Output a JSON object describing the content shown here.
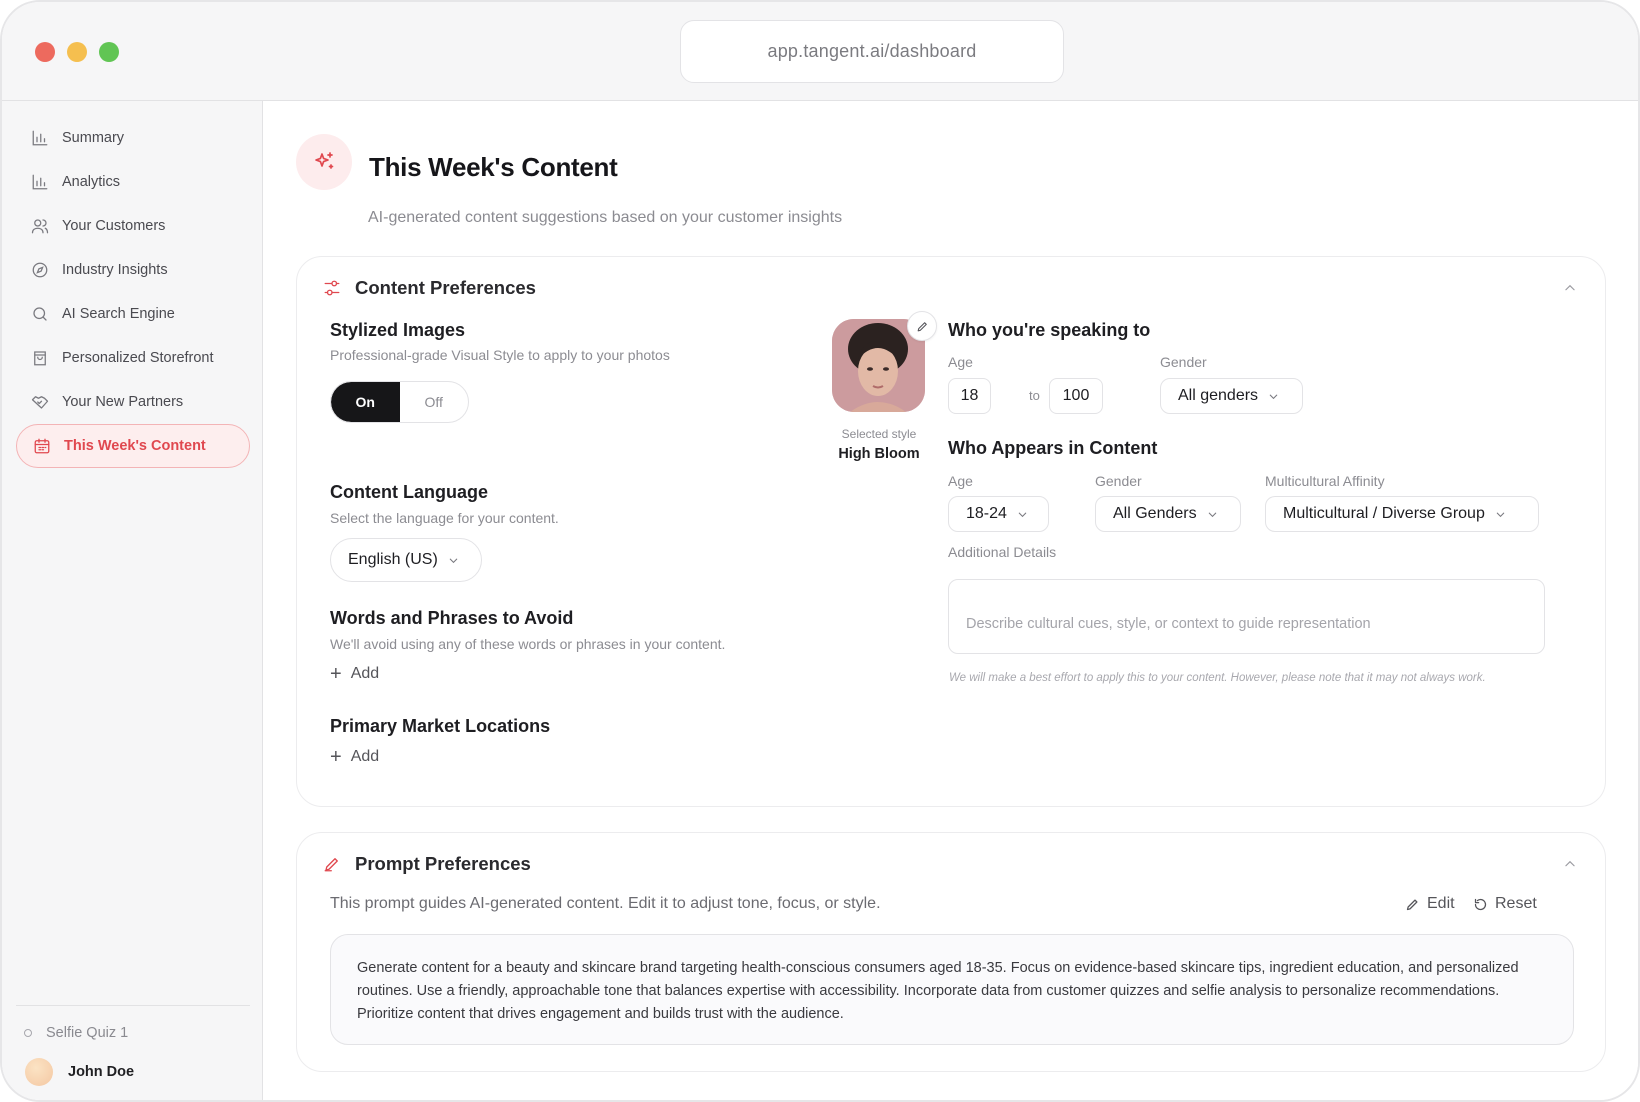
{
  "window": {
    "url": "app.tangent.ai/dashboard"
  },
  "sidebar": {
    "items": [
      {
        "label": "Summary",
        "icon": "bar-chart-icon"
      },
      {
        "label": "Analytics",
        "icon": "bar-chart-icon"
      },
      {
        "label": "Your Customers",
        "icon": "users-icon"
      },
      {
        "label": "Industry Insights",
        "icon": "compass-icon"
      },
      {
        "label": "AI Search Engine",
        "icon": "search-icon"
      },
      {
        "label": "Personalized Storefront",
        "icon": "bag-icon"
      },
      {
        "label": "Your New Partners",
        "icon": "handshake-icon"
      },
      {
        "label": "This Week's Content",
        "icon": "calendar-icon",
        "active": true
      }
    ],
    "quiz_label": "Selfie Quiz 1",
    "user_name": "John Doe"
  },
  "page": {
    "title": "This Week's Content",
    "subtitle": "AI-generated content suggestions based on your customer insights",
    "accent_color": "#e0484f"
  },
  "content_preferences": {
    "title": "Content Preferences",
    "stylized_images": {
      "title": "Stylized Images",
      "description": "Professional-grade Visual Style to apply to your photos",
      "on_label": "On",
      "off_label": "Off",
      "selected": "On",
      "selected_style_caption": "Selected style",
      "selected_style_name": "High Bloom"
    },
    "content_language": {
      "title": "Content Language",
      "description": "Select the language for your content.",
      "value": "English (US)"
    },
    "words_to_avoid": {
      "title": "Words and Phrases to Avoid",
      "description": "We'll avoid using any of these words or phrases in your content.",
      "add_label": "Add"
    },
    "primary_markets": {
      "title": "Primary Market Locations",
      "add_label": "Add"
    },
    "speaking_to": {
      "title": "Who you're speaking to",
      "age_label": "Age",
      "age_min": "18",
      "to_label": "to",
      "age_max": "100",
      "gender_label": "Gender",
      "gender_value": "All genders"
    },
    "appears_in": {
      "title": "Who Appears in Content",
      "age_label": "Age",
      "age_value": "18-24",
      "gender_label": "Gender",
      "gender_value": "All Genders",
      "affinity_label": "Multicultural Affinity",
      "affinity_value": "Multicultural / Diverse Group",
      "details_label": "Additional Details",
      "details_placeholder": "Describe cultural cues, style, or context to guide representation",
      "note": "We will make a best effort to apply this to your content. However, please note that it may not always work."
    }
  },
  "prompt_preferences": {
    "title": "Prompt Preferences",
    "intro": "This prompt guides AI-generated content. Edit it to adjust tone, focus, or style.",
    "edit_label": "Edit",
    "reset_label": "Reset",
    "prompt_text": "Generate content for a beauty and skincare brand targeting health-conscious consumers aged 18-35. Focus on evidence-based skincare tips, ingredient education, and personalized routines. Use a friendly, approachable tone that balances expertise with accessibility. Incorporate data from customer quizzes and selfie analysis to personalize recommendations. Prioritize content that drives engagement and builds trust with the audience."
  }
}
